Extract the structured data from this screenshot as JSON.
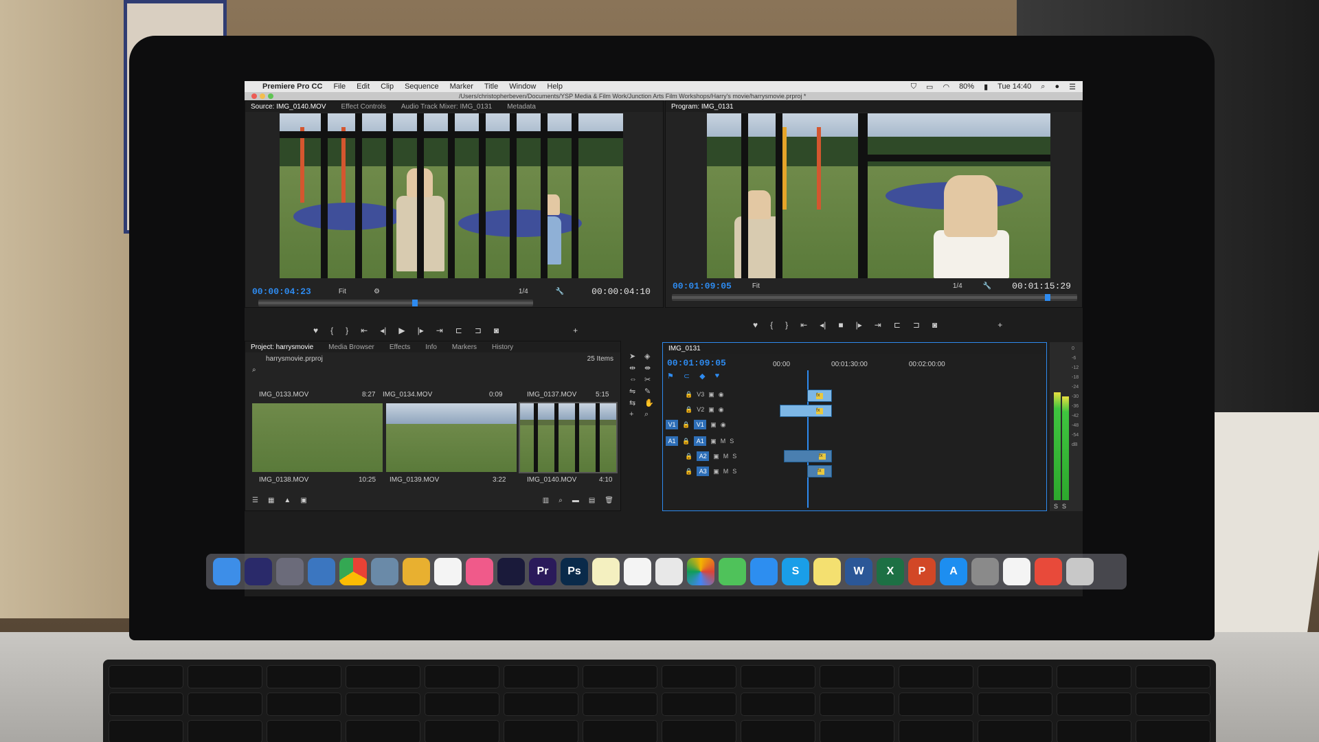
{
  "menubar": {
    "apple_icon": "apple-icon",
    "app_name": "Premiere Pro CC",
    "items": [
      "File",
      "Edit",
      "Clip",
      "Sequence",
      "Marker",
      "Title",
      "Window",
      "Help"
    ],
    "battery": "80%",
    "clock": "Tue 14:40"
  },
  "pathbar": {
    "path": "/Users/christopherbeven/Documents/YSP Media & Film Work/Junction Arts Film Workshops/Harry's movie/harrysmovie.prproj *"
  },
  "source_monitor": {
    "tabs": [
      "Source: IMG_0140.MOV",
      "Effect Controls",
      "Audio Track Mixer: IMG_0131",
      "Metadata"
    ],
    "timecode": "00:00:04:23",
    "fit": "Fit",
    "resolution": "1/4",
    "duration": "00:00:04:10",
    "playhead_fraction": 0.56
  },
  "program_monitor": {
    "tab": "Program: IMG_0131",
    "timecode": "00:01:09:05",
    "fit": "Fit",
    "resolution": "1/4",
    "duration": "00:01:15:29",
    "playhead_fraction": 0.92
  },
  "transport": {
    "marker": "♥",
    "in": "{",
    "out": "}",
    "go_in": "⇤",
    "step_back": "◂|",
    "play": "▶",
    "stop": "■",
    "step_fwd": "|▸",
    "go_out": "⇥",
    "insert": "⊏",
    "overwrite": "⊐",
    "export_frame": "◙",
    "add": "+"
  },
  "project_panel": {
    "tabs": [
      "Project: harrysmovie",
      "Media Browser",
      "Effects",
      "Info",
      "Markers",
      "History"
    ],
    "project_file": "harrysmovie.prproj",
    "item_count": "25 Items",
    "clips": [
      {
        "name": "IMG_0133.MOV",
        "duration": "8:27"
      },
      {
        "name": "IMG_0134.MOV",
        "duration": "0:09"
      },
      {
        "name": "IMG_0137.MOV",
        "duration": "5:15"
      },
      {
        "name": "IMG_0138.MOV",
        "duration": "10:25"
      },
      {
        "name": "IMG_0139.MOV",
        "duration": "3:22"
      },
      {
        "name": "IMG_0140.MOV",
        "duration": "4:10"
      }
    ]
  },
  "timeline": {
    "sequence_name": "IMG_0131",
    "timecode": "00:01:09:05",
    "ruler": [
      "00:00",
      "00:01:30:00",
      "00:02:00:00"
    ],
    "video_tracks": [
      "V3",
      "V2",
      "V1"
    ],
    "audio_tracks": [
      "A1",
      "A2",
      "A3"
    ],
    "source_patch_video": "V1",
    "source_patch_audio": "A1",
    "track_m": "M",
    "track_s": "S",
    "fx_label": "fx"
  },
  "audio_meter": {
    "scale": [
      "0",
      "-6",
      "-12",
      "-18",
      "-24",
      "-30",
      "-36",
      "-42",
      "-48",
      "-54",
      "dB"
    ],
    "solo_left": "S",
    "solo_right": "S",
    "level_fraction": 0.75
  },
  "dock": {
    "apps": [
      {
        "name": "finder",
        "label": ""
      },
      {
        "name": "siri",
        "label": ""
      },
      {
        "name": "launchpad",
        "label": ""
      },
      {
        "name": "preview",
        "label": ""
      },
      {
        "name": "chrome",
        "label": ""
      },
      {
        "name": "image-capture",
        "label": ""
      },
      {
        "name": "notes",
        "label": ""
      },
      {
        "name": "calendar",
        "label": ""
      },
      {
        "name": "itunes",
        "label": ""
      },
      {
        "name": "quicktime",
        "label": ""
      },
      {
        "name": "premiere",
        "label": "Pr"
      },
      {
        "name": "photoshop",
        "label": "Ps"
      },
      {
        "name": "text-file",
        "label": ""
      },
      {
        "name": "text-file-2",
        "label": ""
      },
      {
        "name": "document",
        "label": ""
      },
      {
        "name": "photos",
        "label": ""
      },
      {
        "name": "messages",
        "label": ""
      },
      {
        "name": "safari",
        "label": ""
      },
      {
        "name": "skype",
        "label": "S"
      },
      {
        "name": "stickies",
        "label": ""
      },
      {
        "name": "word",
        "label": "W"
      },
      {
        "name": "excel",
        "label": "X"
      },
      {
        "name": "powerpoint",
        "label": "P"
      },
      {
        "name": "app-store",
        "label": "A"
      },
      {
        "name": "system-preferences",
        "label": ""
      },
      {
        "name": "blank-doc",
        "label": ""
      },
      {
        "name": "creative-cloud-folder",
        "label": ""
      },
      {
        "name": "trash",
        "label": ""
      }
    ]
  },
  "colors": {
    "accent": "#2e8bf0",
    "panel_bg": "#232323",
    "timecode_blue": "#2e8bf0",
    "premiere": "#2a1a5a",
    "photoshop": "#0a2a4a"
  }
}
